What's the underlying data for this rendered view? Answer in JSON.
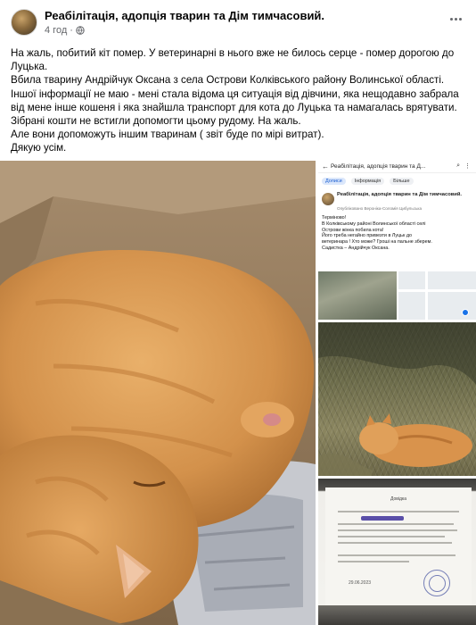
{
  "post": {
    "page_name": "Реабілітація, адопція тварин та Дім тимчасовий.",
    "time": "4 год",
    "privacy_icon": "globe-icon",
    "more_icon": "more-options-icon",
    "text_lines": [
      "На жаль, побитий кіт помер. У ветеринарні в нього вже не билось серце - помер дорогою до",
      "Луцька.",
      "Вбила тварину Андрійчук Оксана з села Острови Колківського району Волинської області.",
      "Іншої інформації не маю - мені стала відома ця ситуація від дівчини, яка нещодавно забрала",
      "від мене інше кошеня і яка знайшла транспорт для кота до Луцька та намагалась врятувати.",
      "Зібрані кошти не встигли допомогти цьому рудому. На жаль.",
      "Але вони допоможуть іншим тваринам ( звіт буде по мірі витрат).",
      "Дякую усім."
    ]
  },
  "screenshot": {
    "header_title": "Реабілітація, адопція тварин та Д...",
    "search_icon": "search-icon",
    "more_icon": "more-options-icon",
    "back_icon": "back-arrow-icon",
    "tabs": [
      "Дописи",
      "Інформація",
      "Більше"
    ],
    "author": "Реабілітація, адопція тварин та Дім тимчасовий.",
    "sub": "Опубліковано Вероніка-Соломія Цибульська",
    "text_lines": [
      "Терміново!",
      "В Колківському районі Волинської області селі",
      "Острови жінка побила кота!",
      "Його треба негайно привезти в Луцьк до",
      "ветеринара ! Хто може? Гроші на пальне зберем.",
      "Садистка – Андрійчук Оксана."
    ]
  },
  "document": {
    "title": "Довідка",
    "date": "29.06.2023"
  },
  "colors": {
    "text": "#050505",
    "meta": "#65676b",
    "cat_orange": "#d99a4e"
  }
}
